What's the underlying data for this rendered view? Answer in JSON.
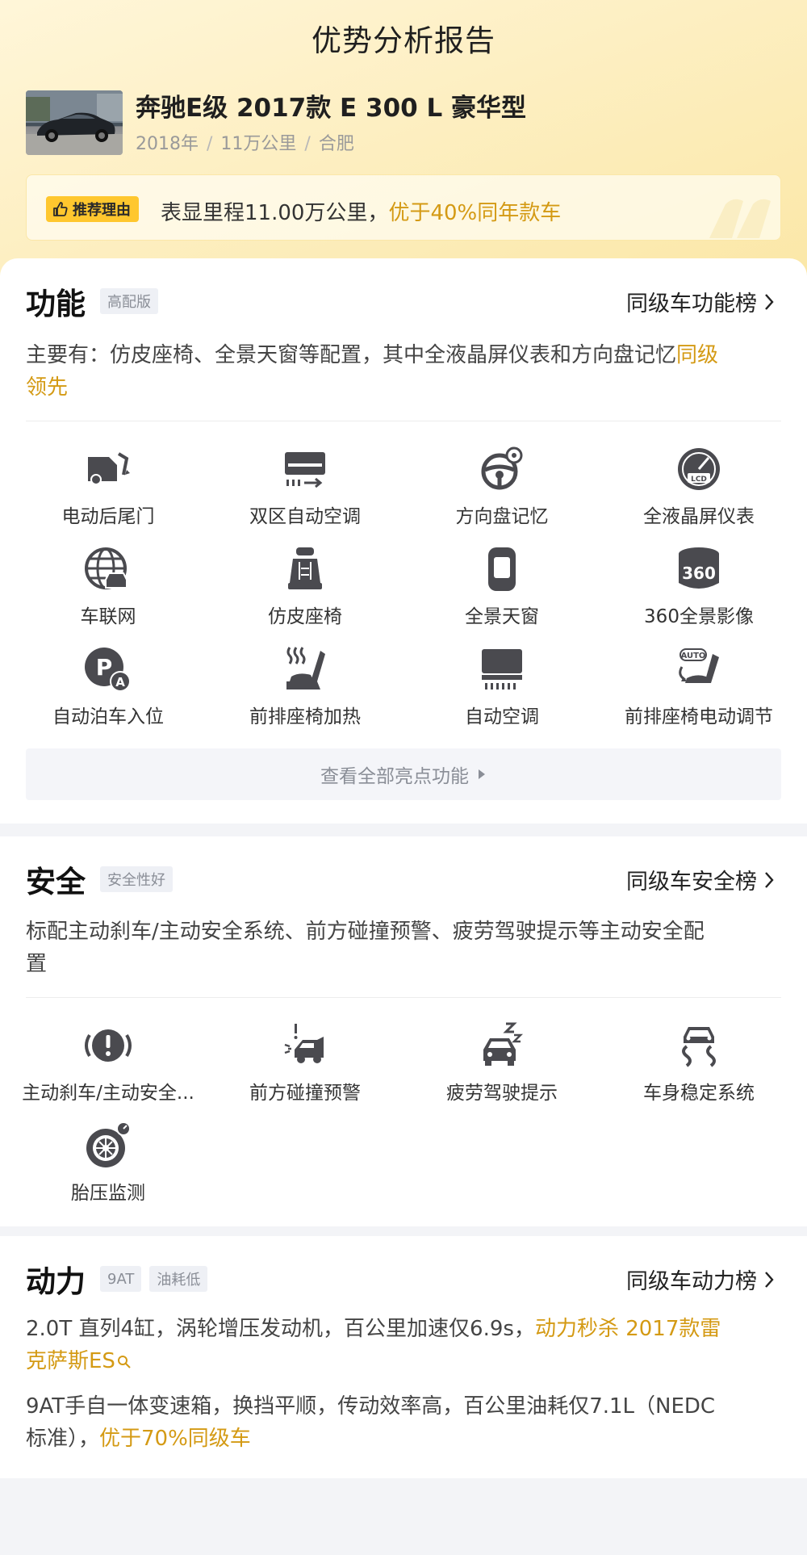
{
  "page_title": "优势分析报告",
  "car": {
    "name": "奔驰E级 2017款 E 300 L 豪华型",
    "year": "2018年",
    "mileage": "11万公里",
    "city": "合肥"
  },
  "reason": {
    "badge": "推荐理由",
    "text": "表显里程11.00万公里，",
    "highlight": "优于40%同年款车"
  },
  "function": {
    "title": "功能",
    "tag": "高配版",
    "rank_link": "同级车功能榜",
    "desc_line1": "主要有：仿皮座椅、全景天窗等配置，其中全液晶屏仪表和方向盘记忆",
    "desc_hl1": "同级",
    "desc_hl2": "领先",
    "features": [
      {
        "label": "电动后尾门",
        "icon": "power-tailgate-icon"
      },
      {
        "label": "双区自动空调",
        "icon": "dual-zone-ac-icon"
      },
      {
        "label": "方向盘记忆",
        "icon": "steering-memory-icon"
      },
      {
        "label": "全液晶屏仪表",
        "icon": "lcd-dashboard-icon"
      },
      {
        "label": "车联网",
        "icon": "connected-car-icon"
      },
      {
        "label": "仿皮座椅",
        "icon": "leather-seat-icon"
      },
      {
        "label": "全景天窗",
        "icon": "panoramic-sunroof-icon"
      },
      {
        "label": "360全景影像",
        "icon": "360-camera-icon"
      },
      {
        "label": "自动泊车入位",
        "icon": "auto-parking-icon"
      },
      {
        "label": "前排座椅加热",
        "icon": "seat-heating-icon"
      },
      {
        "label": "自动空调",
        "icon": "auto-ac-icon"
      },
      {
        "label": "前排座椅电动调节",
        "icon": "power-seat-icon"
      }
    ],
    "view_all": "查看全部亮点功能"
  },
  "safety": {
    "title": "安全",
    "tag": "安全性好",
    "rank_link": "同级车安全榜",
    "desc_line1": "标配主动刹车/主动安全系统、前方碰撞预警、疲劳驾驶提示等主动安全配",
    "desc_line2": "置",
    "features": [
      {
        "label": "主动刹车/主动安全...",
        "icon": "active-brake-icon"
      },
      {
        "label": "前方碰撞预警",
        "icon": "collision-warning-icon"
      },
      {
        "label": "疲劳驾驶提示",
        "icon": "fatigue-alert-icon"
      },
      {
        "label": "车身稳定系统",
        "icon": "stability-control-icon"
      },
      {
        "label": "胎压监测",
        "icon": "tire-pressure-icon"
      }
    ]
  },
  "power": {
    "title": "动力",
    "tag1": "9AT",
    "tag2": "油耗低",
    "rank_link": "同级车动力榜",
    "line1_text": "2.0T 直列4缸，涡轮增压发动机，百公里加速仅6.9s，",
    "line1_hl": "动力秒杀 2017款雷",
    "line2_hl": "克萨斯ES",
    "line3_text": "9AT手自一体变速箱，换挡平顺，传动效率高，百公里油耗仅7.1L（NEDC",
    "line4_text": "标准），",
    "line4_hl": "优于70%同级车"
  },
  "colors": {
    "accent": "#d49a14",
    "badge": "#ffc72e",
    "icon": "#4a4a4f"
  }
}
